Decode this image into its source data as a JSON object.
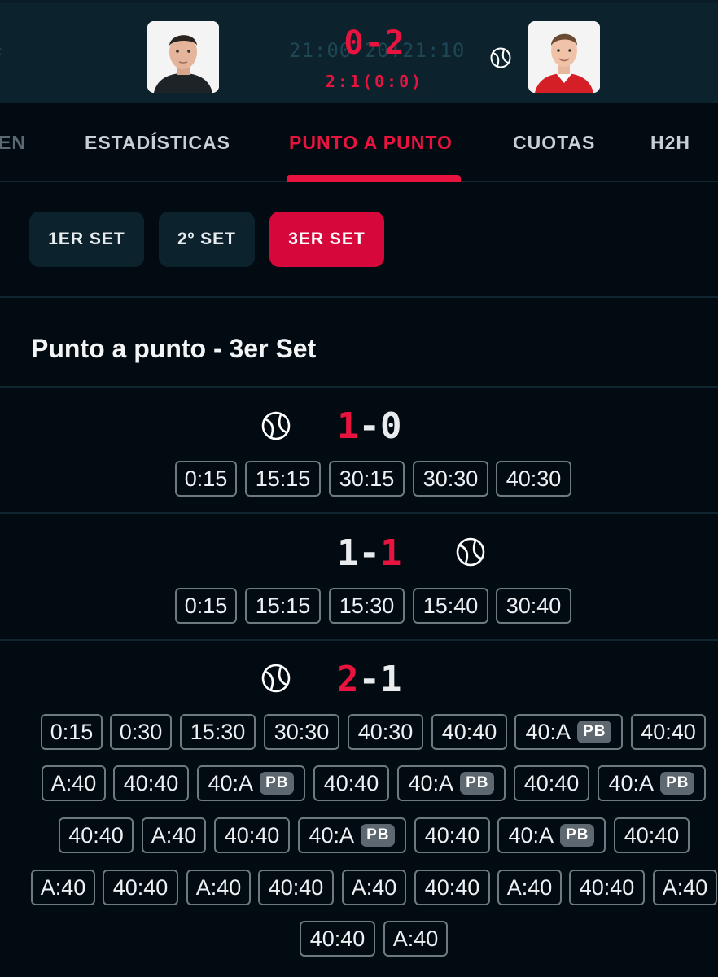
{
  "header": {
    "ghost_text": "21:00 20:21:10",
    "match_score": "0-2",
    "set_score": "2:1(0:0)",
    "player1_avatar": "player-photo",
    "player2_avatar": "player-photo",
    "server_icon": "tennis-ball-icon"
  },
  "tabs": [
    {
      "label": "EN"
    },
    {
      "label": "ESTADÍSTICAS"
    },
    {
      "label": "PUNTO A PUNTO",
      "active": true
    },
    {
      "label": "CUOTAS"
    },
    {
      "label": "H2H"
    }
  ],
  "sets": [
    {
      "label": "1ER SET"
    },
    {
      "label": "2º SET"
    },
    {
      "label": "3ER SET",
      "active": true
    }
  ],
  "section_title": "Punto a punto - 3er Set",
  "games": [
    {
      "home": "1",
      "sep": "-",
      "away": "0",
      "winner": "home",
      "server": "home",
      "points": [
        {
          "score": "0:15"
        },
        {
          "score": "15:15"
        },
        {
          "score": "30:15"
        },
        {
          "score": "30:30"
        },
        {
          "score": "40:30"
        }
      ]
    },
    {
      "home": "1",
      "sep": "-",
      "away": "1",
      "winner": "away",
      "server": "away",
      "points": [
        {
          "score": "0:15"
        },
        {
          "score": "15:15"
        },
        {
          "score": "15:30"
        },
        {
          "score": "15:40"
        },
        {
          "score": "30:40"
        }
      ]
    },
    {
      "home": "2",
      "sep": "-",
      "away": "1",
      "winner": "home",
      "server": "home",
      "points": [
        {
          "score": "0:15"
        },
        {
          "score": "0:30"
        },
        {
          "score": "15:30"
        },
        {
          "score": "30:30"
        },
        {
          "score": "40:30"
        },
        {
          "score": "40:40"
        },
        {
          "score": "40:A",
          "badge": "PB"
        },
        {
          "score": "40:40"
        },
        {
          "score": "A:40"
        },
        {
          "score": "40:40"
        },
        {
          "score": "40:A",
          "badge": "PB"
        },
        {
          "score": "40:40"
        },
        {
          "score": "40:A",
          "badge": "PB"
        },
        {
          "score": "40:40"
        },
        {
          "score": "40:A",
          "badge": "PB"
        },
        {
          "score": "40:40"
        },
        {
          "score": "A:40"
        },
        {
          "score": "40:40"
        },
        {
          "score": "40:A",
          "badge": "PB"
        },
        {
          "score": "40:40"
        },
        {
          "score": "40:A",
          "badge": "PB"
        },
        {
          "score": "40:40"
        },
        {
          "score": "A:40"
        },
        {
          "score": "40:40"
        },
        {
          "score": "A:40"
        },
        {
          "score": "40:40"
        },
        {
          "score": "A:40"
        },
        {
          "score": "40:40"
        },
        {
          "score": "A:40"
        },
        {
          "score": "40:40"
        },
        {
          "score": "A:40"
        },
        {
          "score": "40:40"
        },
        {
          "score": "A:40"
        }
      ]
    }
  ],
  "colors": {
    "accent": "#e8133f",
    "background": "#030b12",
    "panel": "#0c232e"
  }
}
